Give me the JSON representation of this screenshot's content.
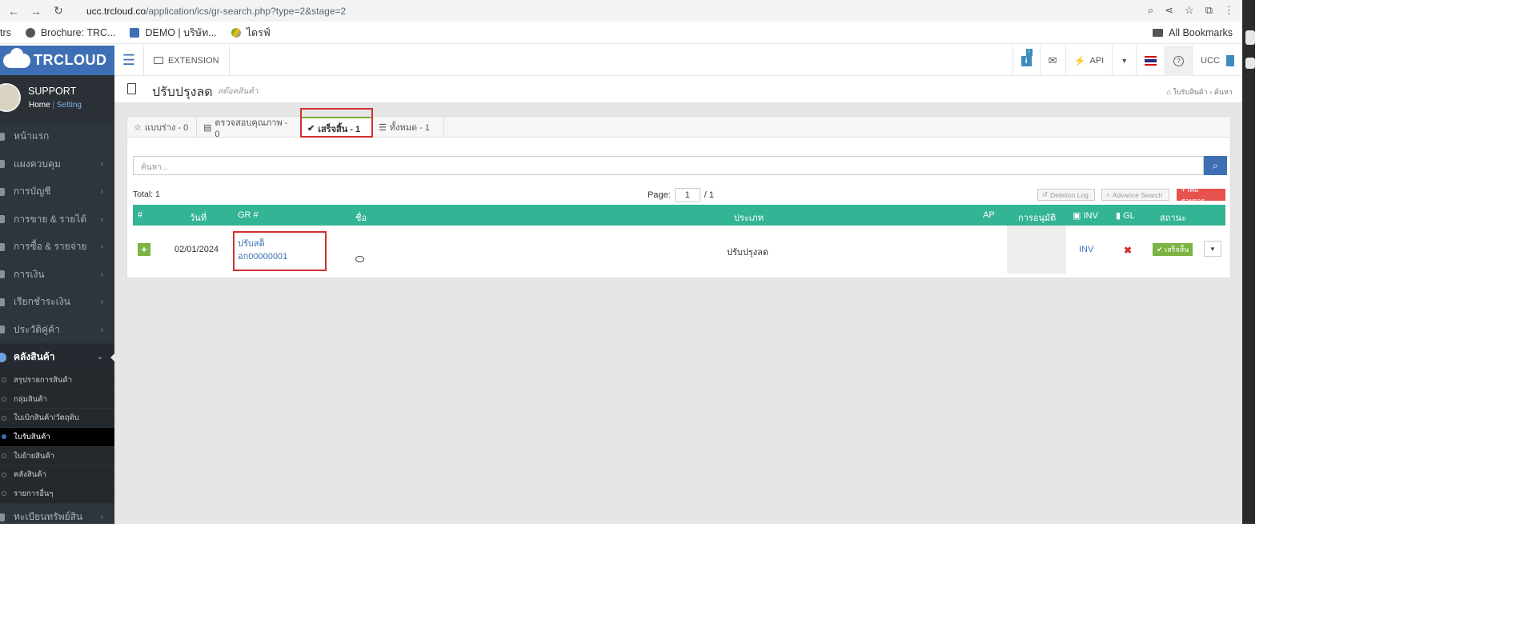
{
  "browser": {
    "url_host": "ucc.trcloud.co",
    "url_path": "/application/ics/gr-search.php?type=2&stage=2",
    "bookmarks": [
      "trs",
      "Brochure: TRC...",
      "DEMO | บริษัท...",
      "ไดรฟ์"
    ],
    "all_bookmarks": "All Bookmarks"
  },
  "sidebar": {
    "logo": "TRCLOUD",
    "profile_name": "SUPPORT",
    "home_link": "Home",
    "separator": "|",
    "setting_link": "Setting",
    "items": [
      {
        "label": "หน้าแรก"
      },
      {
        "label": "แผงควบคุม"
      },
      {
        "label": "การบัญชี"
      },
      {
        "label": "การขาย & รายได้"
      },
      {
        "label": "การซื้อ & รายจ่าย"
      },
      {
        "label": "การเงิน"
      },
      {
        "label": "เรียกชำระเงิน"
      },
      {
        "label": "ประวัติคู่ค้า"
      }
    ],
    "active_item": "คลังสินค้า",
    "sub_items": [
      {
        "label": "สรุปรายการสินค้า"
      },
      {
        "label": "กลุ่มสินค้า"
      },
      {
        "label": "ใบเบิกสินค้า/วัตถุดิบ"
      },
      {
        "label": "ใบรับสินค้า"
      },
      {
        "label": "ใบย้ายสินค้า"
      },
      {
        "label": "คลังสินค้า"
      },
      {
        "label": "รายการอื่นๆ"
      }
    ],
    "last_item": "ทะเบียนทรัพย์สิน"
  },
  "topbar": {
    "extension": "EXTENSION",
    "badge": "!",
    "api": "API",
    "company": "UCC"
  },
  "page": {
    "title": "ปรับปรุงลด",
    "subtitle": "สต๊อคสินค้า",
    "breadcrumb": [
      "ใบรับสินค้า",
      "ค้นหา"
    ]
  },
  "tabs": [
    {
      "label": "แบบร่าง - 0"
    },
    {
      "label": "ตรวจสอบคุณภาพ - 0"
    },
    {
      "label": "เสร็จสิ้น - 1"
    },
    {
      "label": "ทั้งหมด - 1"
    }
  ],
  "search": {
    "placeholder": "ค้นหา..."
  },
  "listing": {
    "total": "Total: 1",
    "page_label": "Page:",
    "page_value": "1",
    "page_total": "/ 1",
    "deletion_log": "Deletion Log",
    "advance_search": "Advance Search",
    "add_button": "+ เพิ่มรายการ"
  },
  "table": {
    "headers": [
      "#",
      "วันที่",
      "GR #",
      "ชื่อ",
      "ประเภท",
      "AP",
      "การอนุมัติ",
      "INV",
      "GL",
      "สถานะ"
    ],
    "rows": [
      {
        "expand": "+",
        "date": "02/01/2024",
        "gr_line1": "ปรับสต็",
        "gr_line2": "อก00000001",
        "type": "ปรับปรุงลด",
        "inv": "INV",
        "gl": "✖",
        "status": "✔ เสร็จสิ้น"
      }
    ]
  },
  "colors": {
    "brand_blue": "#3e6fb5",
    "table_header": "#33b494",
    "success_green": "#7cb342",
    "highlight_red": "#d32f2f"
  }
}
